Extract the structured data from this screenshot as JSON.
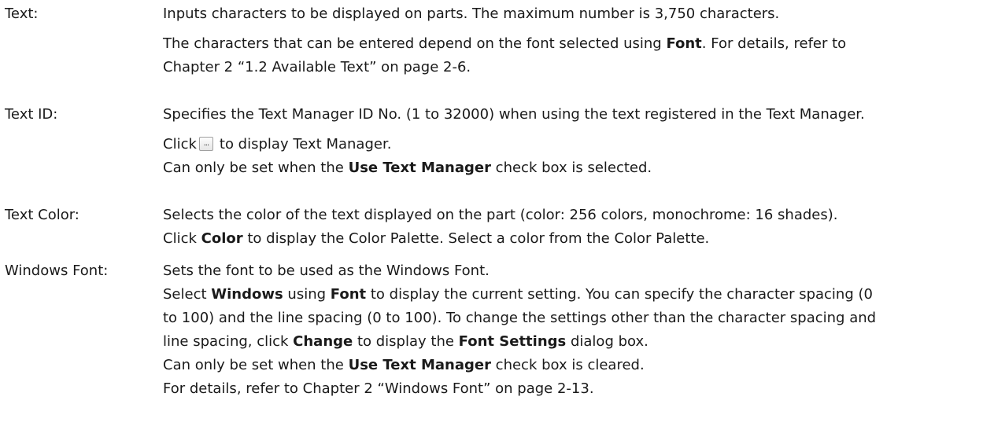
{
  "entries": {
    "text": {
      "term": "Text:",
      "p1": "Inputs characters to be displayed on parts. The maximum number is 3,750 characters.",
      "p2_a": "The characters that can be entered depend on the font selected using ",
      "p2_b": "Font",
      "p2_c": ". For details, refer to",
      "p2_d": "Chapter 2 “1.2 Available Text” on page 2-6."
    },
    "text_id": {
      "term": "Text ID:",
      "p1": "Specifies the Text Manager ID No. (1 to 32000) when using the text registered in the Text Manager.",
      "p2_a": "Click",
      "p2_icon": "...",
      "p2_b": "to display Text Manager.",
      "p3_a": "Can only be set when the ",
      "p3_b": "Use Text Manager",
      "p3_c": " check box is selected."
    },
    "text_color": {
      "term": "Text Color:",
      "p1": "Selects the color of the text displayed on the part (color: 256 colors, monochrome: 16 shades).",
      "p2_a": "Click ",
      "p2_b": "Color",
      "p2_c": " to display the Color Palette. Select a color from the Color Palette."
    },
    "windows_font": {
      "term": "Windows Font:",
      "p1": "Sets the font to be used as the Windows Font.",
      "p2_a": "Select ",
      "p2_b": "Windows",
      "p2_c": " using ",
      "p2_d": "Font",
      "p2_e": " to display the current setting. You can specify the character spacing (0",
      "p2_f": "to 100) and the line spacing (0 to 100). To change the settings other than the character spacing and",
      "p2_g": "line spacing, click ",
      "p2_h": "Change",
      "p2_i": " to display the ",
      "p2_j": "Font Settings",
      "p2_k": " dialog box.",
      "p3_a": "Can only be set when the ",
      "p3_b": "Use Text Manager",
      "p3_c": " check box is cleared.",
      "p4": "For details, refer to Chapter 2 “Windows Font” on page 2-13."
    }
  },
  "icons": {
    "browse_button": "ellipsis-button-icon"
  }
}
